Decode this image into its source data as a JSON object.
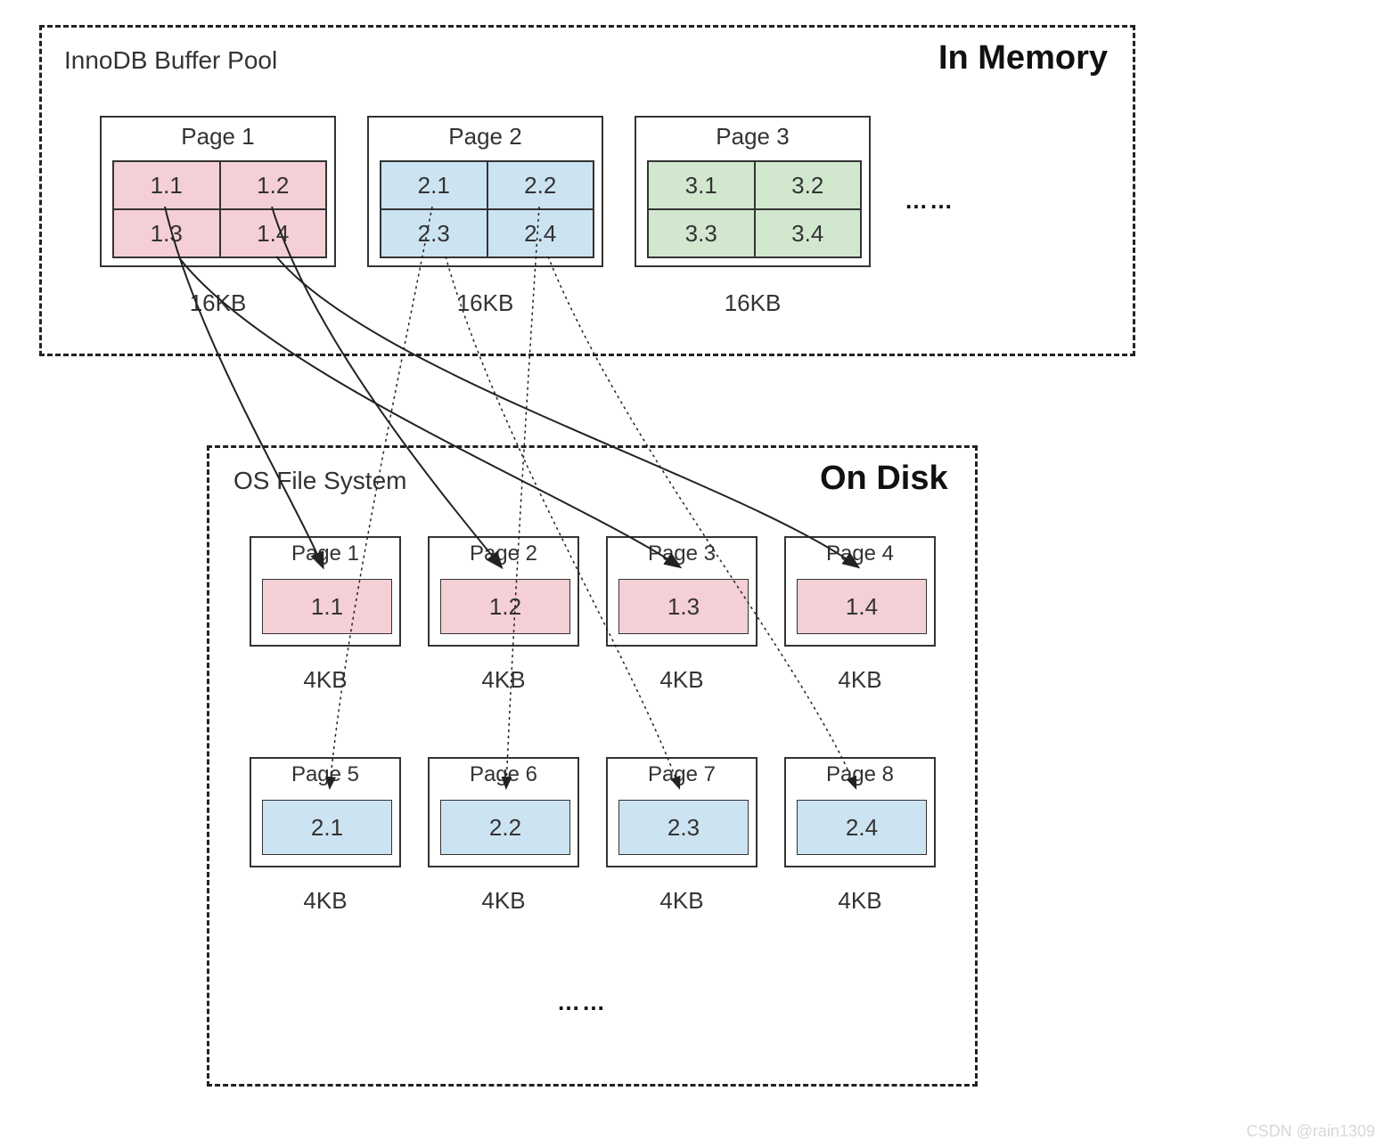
{
  "memory": {
    "label_left": "InnoDB Buffer Pool",
    "label_right": "In Memory",
    "pages": [
      {
        "title": "Page 1",
        "size": "16KB",
        "cells": [
          "1.1",
          "1.2",
          "1.3",
          "1.4"
        ],
        "color": "pink"
      },
      {
        "title": "Page 2",
        "size": "16KB",
        "cells": [
          "2.1",
          "2.2",
          "2.3",
          "2.4"
        ],
        "color": "blue"
      },
      {
        "title": "Page 3",
        "size": "16KB",
        "cells": [
          "3.1",
          "3.2",
          "3.3",
          "3.4"
        ],
        "color": "green"
      }
    ],
    "ellipsis": "……"
  },
  "disk": {
    "label_left": "OS File System",
    "label_right": "On Disk",
    "row1": [
      {
        "title": "Page 1",
        "cell": "1.1",
        "size": "4KB",
        "color": "pink"
      },
      {
        "title": "Page 2",
        "cell": "1.2",
        "size": "4KB",
        "color": "pink"
      },
      {
        "title": "Page 3",
        "cell": "1.3",
        "size": "4KB",
        "color": "pink"
      },
      {
        "title": "Page 4",
        "cell": "1.4",
        "size": "4KB",
        "color": "pink"
      }
    ],
    "row2": [
      {
        "title": "Page 5",
        "cell": "2.1",
        "size": "4KB",
        "color": "blue"
      },
      {
        "title": "Page 6",
        "cell": "2.2",
        "size": "4KB",
        "color": "blue"
      },
      {
        "title": "Page 7",
        "cell": "2.3",
        "size": "4KB",
        "color": "blue"
      },
      {
        "title": "Page 8",
        "cell": "2.4",
        "size": "4KB",
        "color": "blue"
      }
    ],
    "ellipsis": "……"
  },
  "watermark": "CSDN @rain1309"
}
